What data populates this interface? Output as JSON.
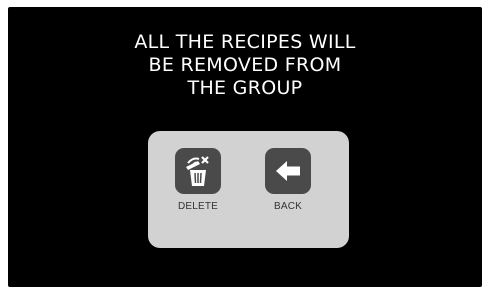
{
  "message": {
    "lines": [
      "ALL THE RECIPES WILL",
      "BE REMOVED FROM",
      "THE GROUP"
    ]
  },
  "actions": {
    "delete": {
      "label": "DELETE",
      "icon": "trash-icon"
    },
    "back": {
      "label": "BACK",
      "icon": "arrow-left-icon"
    }
  },
  "colors": {
    "background": "#000000",
    "card": "#d2d2d2",
    "tile": "#4a4a4a",
    "icon": "#ffffff",
    "text": "#ffffff"
  }
}
